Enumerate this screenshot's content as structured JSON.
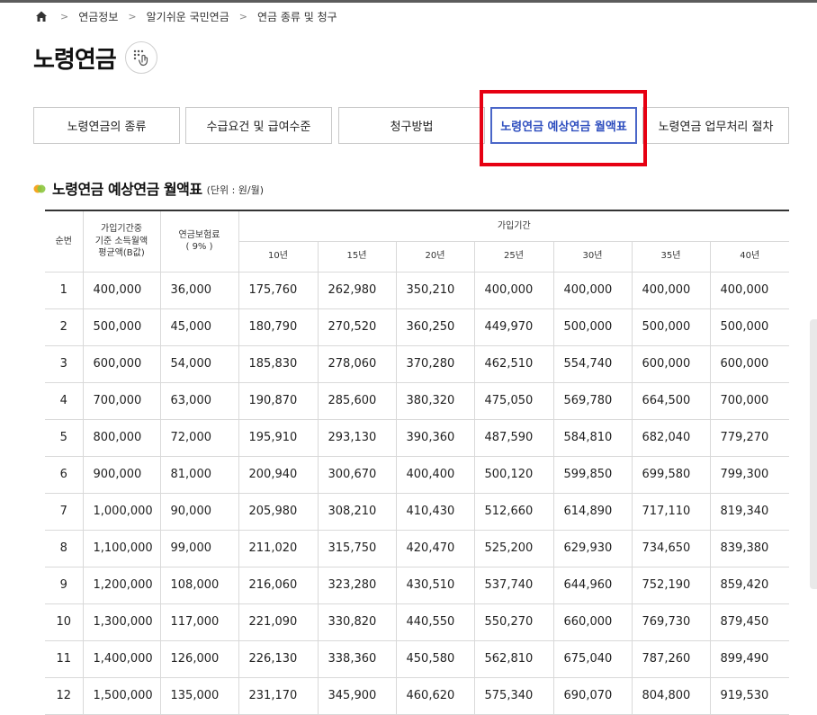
{
  "breadcrumb": {
    "home_icon": "home-icon",
    "items": [
      "연금정보",
      "알기쉬운 국민연금",
      "연금 종류 및 청구"
    ]
  },
  "page": {
    "title": "노령연금",
    "braille_icon": "braille-hand-icon"
  },
  "tabs": [
    {
      "label": "노령연금의 종류",
      "active": false
    },
    {
      "label": "수급요건 및 급여수준",
      "active": false
    },
    {
      "label": "청구방법",
      "active": false
    },
    {
      "label": "노령연금 예상연금 월액표",
      "active": true
    },
    {
      "label": "노령연금 업무처리 절차",
      "active": false
    }
  ],
  "colors": {
    "active_tab": "#4a66c8",
    "highlight_box": "#e60012",
    "bullet_green": "#8cc63f",
    "bullet_orange": "#f5a623"
  },
  "section": {
    "title": "노령연금 예상연금 월액표",
    "unit": "(단위 : 원/월)"
  },
  "table": {
    "headers": {
      "no": "순번",
      "income": [
        "가입기간중",
        "기준 소득월액",
        "평균액(B값)"
      ],
      "premium": [
        "연금보험료",
        "( 9% )"
      ],
      "period": "가입기간",
      "years": [
        "10년",
        "15년",
        "20년",
        "25년",
        "30년",
        "35년",
        "40년"
      ]
    },
    "rows": [
      [
        "1",
        "400,000",
        "36,000",
        "175,760",
        "262,980",
        "350,210",
        "400,000",
        "400,000",
        "400,000",
        "400,000"
      ],
      [
        "2",
        "500,000",
        "45,000",
        "180,790",
        "270,520",
        "360,250",
        "449,970",
        "500,000",
        "500,000",
        "500,000"
      ],
      [
        "3",
        "600,000",
        "54,000",
        "185,830",
        "278,060",
        "370,280",
        "462,510",
        "554,740",
        "600,000",
        "600,000"
      ],
      [
        "4",
        "700,000",
        "63,000",
        "190,870",
        "285,600",
        "380,320",
        "475,050",
        "569,780",
        "664,500",
        "700,000"
      ],
      [
        "5",
        "800,000",
        "72,000",
        "195,910",
        "293,130",
        "390,360",
        "487,590",
        "584,810",
        "682,040",
        "779,270"
      ],
      [
        "6",
        "900,000",
        "81,000",
        "200,940",
        "300,670",
        "400,400",
        "500,120",
        "599,850",
        "699,580",
        "799,300"
      ],
      [
        "7",
        "1,000,000",
        "90,000",
        "205,980",
        "308,210",
        "410,430",
        "512,660",
        "614,890",
        "717,110",
        "819,340"
      ],
      [
        "8",
        "1,100,000",
        "99,000",
        "211,020",
        "315,750",
        "420,470",
        "525,200",
        "629,930",
        "734,650",
        "839,380"
      ],
      [
        "9",
        "1,200,000",
        "108,000",
        "216,060",
        "323,280",
        "430,510",
        "537,740",
        "644,960",
        "752,190",
        "859,420"
      ],
      [
        "10",
        "1,300,000",
        "117,000",
        "221,090",
        "330,820",
        "440,550",
        "550,270",
        "660,000",
        "769,730",
        "879,450"
      ],
      [
        "11",
        "1,400,000",
        "126,000",
        "226,130",
        "338,360",
        "450,580",
        "562,810",
        "675,040",
        "787,260",
        "899,490"
      ],
      [
        "12",
        "1,500,000",
        "135,000",
        "231,170",
        "345,900",
        "460,620",
        "575,340",
        "690,070",
        "804,800",
        "919,530"
      ]
    ]
  }
}
